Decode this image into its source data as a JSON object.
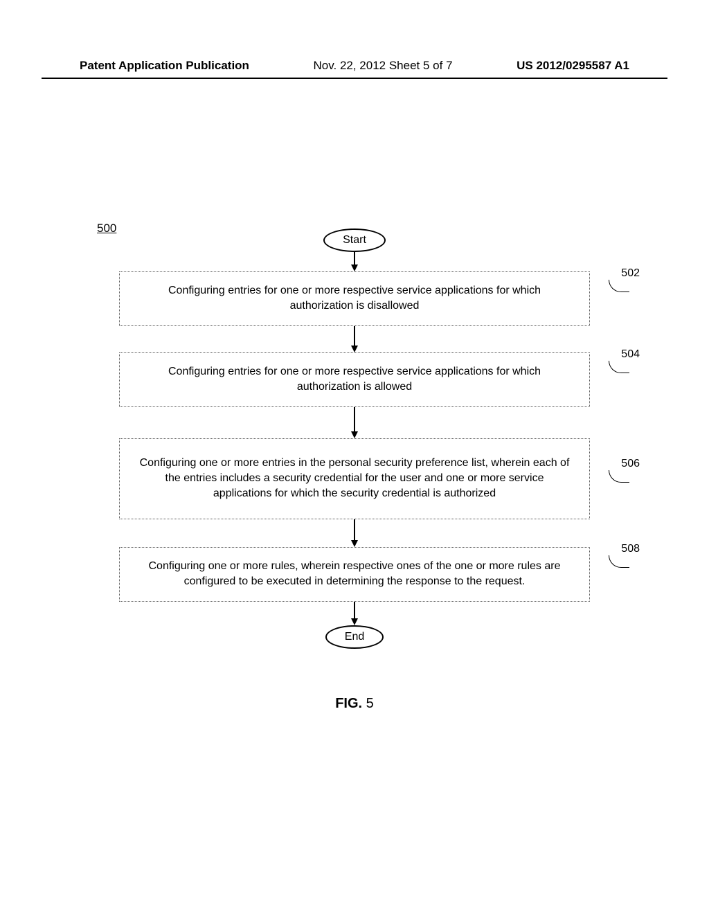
{
  "header": {
    "left": "Patent Application Publication",
    "center": "Nov. 22, 2012  Sheet 5 of 7",
    "right": "US 2012/0295587 A1"
  },
  "figure": {
    "number": "500",
    "caption_prefix": "FIG. ",
    "caption_number": "5"
  },
  "flowchart": {
    "start": "Start",
    "end": "End",
    "steps": [
      {
        "ref": "502",
        "text": "Configuring entries for one or more respective service applications for which authorization is disallowed"
      },
      {
        "ref": "504",
        "text": "Configuring entries for one or more respective service applications for which authorization is allowed"
      },
      {
        "ref": "506",
        "text": "Configuring one or more entries in the personal security preference list, wherein each of the entries includes a security credential for the user and one or more service applications for which the security credential is authorized"
      },
      {
        "ref": "508",
        "text": "Configuring one or more rules, wherein respective ones of the one or more rules are configured to be executed in determining the response to the request."
      }
    ]
  },
  "chart_data": {
    "type": "flowchart",
    "title": "FIG. 5",
    "figure_ref": "500",
    "nodes": [
      {
        "id": "start",
        "type": "terminal",
        "label": "Start"
      },
      {
        "id": "502",
        "type": "process",
        "label": "Configuring entries for one or more respective service applications for which authorization is disallowed"
      },
      {
        "id": "504",
        "type": "process",
        "label": "Configuring entries for one or more respective service applications for which authorization is allowed"
      },
      {
        "id": "506",
        "type": "process",
        "label": "Configuring one or more entries in the personal security preference list, wherein each of the entries includes a security credential for the user and one or more service applications for which the security credential is authorized"
      },
      {
        "id": "508",
        "type": "process",
        "label": "Configuring one or more rules, wherein respective ones of the one or more rules are configured to be executed in determining the response to the request."
      },
      {
        "id": "end",
        "type": "terminal",
        "label": "End"
      }
    ],
    "edges": [
      {
        "from": "start",
        "to": "502"
      },
      {
        "from": "502",
        "to": "504"
      },
      {
        "from": "504",
        "to": "506"
      },
      {
        "from": "506",
        "to": "508"
      },
      {
        "from": "508",
        "to": "end"
      }
    ]
  }
}
